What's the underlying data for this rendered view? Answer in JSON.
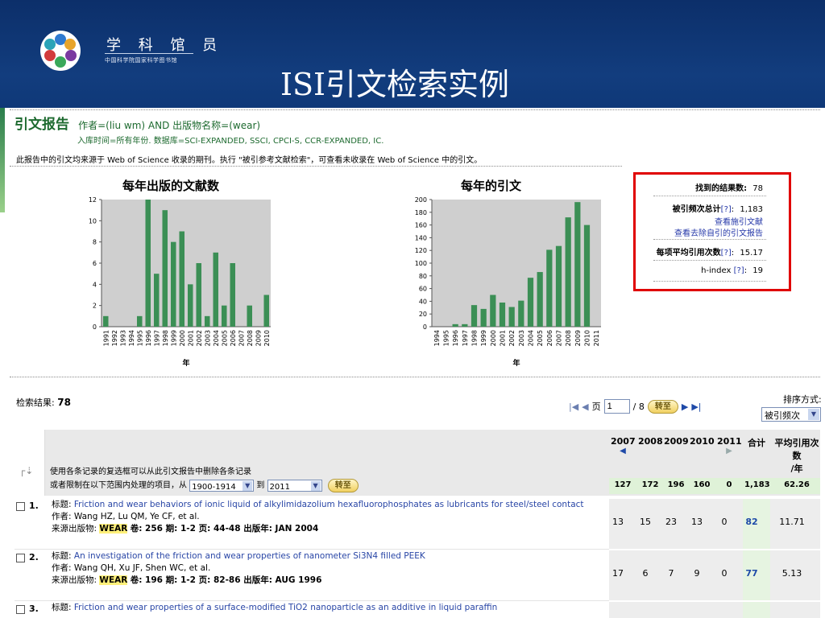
{
  "header": {
    "brand_name": "学 科 馆 员",
    "brand_sub": "中国科学院国家科学图书馆",
    "slide_title": "ISI引文检索实例"
  },
  "report": {
    "title": "引文报告",
    "query": "作者=(liu wm) AND 出版物名称=(wear)",
    "scope": "入库时间=所有年份. 数据库=SCI-EXPANDED, SSCI, CPCI-S, CCR-EXPANDED, IC.",
    "note": "此报告中的引文均来源于 Web of Science 收录的期刊。执行 \"被引参考文献检索\"，可查看未收录在 Web of Science 中的引文。"
  },
  "stats": {
    "results_label": "找到的结果数:",
    "results_value": "78",
    "citations_label": "被引频次总计",
    "citations_help": "[?]",
    "citations_value": "1,183",
    "link_citing": "查看施引文献",
    "link_no_self": "查看去除自引的引文报告",
    "avg_label": "每项平均引用次数",
    "avg_help": "[?]",
    "avg_value": "15.17",
    "hindex_label": "h-index",
    "hindex_help": "[?]",
    "hindex_value": "19"
  },
  "chart_data": [
    {
      "type": "bar",
      "title": "每年出版的文献数",
      "xlabel": "年",
      "ylabel": "",
      "categories": [
        "1991",
        "1992",
        "1993",
        "1994",
        "1995",
        "1996",
        "1997",
        "1998",
        "1999",
        "2000",
        "2001",
        "2002",
        "2003",
        "2004",
        "2005",
        "2006",
        "2007",
        "2008",
        "2009",
        "2010"
      ],
      "values": [
        1,
        0,
        0,
        0,
        1,
        12,
        5,
        11,
        8,
        9,
        4,
        6,
        1,
        7,
        2,
        6,
        0,
        2,
        0,
        3
      ],
      "ylim": [
        0,
        12
      ],
      "yticks": [
        0,
        2,
        4,
        6,
        8,
        10,
        12
      ],
      "grid": false,
      "color": "#3b8f55"
    },
    {
      "type": "bar",
      "title": "每年的引文",
      "xlabel": "年",
      "ylabel": "",
      "categories": [
        "1994",
        "1995",
        "1996",
        "1997",
        "1998",
        "1999",
        "2000",
        "2001",
        "2002",
        "2003",
        "2004",
        "2005",
        "2006",
        "2007",
        "2008",
        "2009",
        "2010",
        "2011"
      ],
      "values": [
        0,
        0,
        4,
        4,
        34,
        28,
        50,
        38,
        31,
        41,
        77,
        86,
        121,
        127,
        172,
        196,
        160,
        0
      ],
      "ylim": [
        0,
        200
      ],
      "yticks": [
        0,
        20,
        40,
        60,
        80,
        100,
        120,
        140,
        160,
        180,
        200
      ],
      "grid": false,
      "color": "#3b8f55"
    }
  ],
  "results_bar": {
    "label": "检索结果:",
    "count": "78",
    "page_label": "页",
    "page_value": "1",
    "page_total": "/ 8",
    "go_label": "转至",
    "sort_label": "排序方式:",
    "sort_value": "被引频次"
  },
  "table": {
    "info_line1": "使用各条记录的复选框可以从此引文报告中删除各条记录",
    "info_line2_prefix": "或者限制在以下范围内处理的项目，从",
    "range_from": "1900-1914",
    "range_to_label": "到",
    "range_to": "2011",
    "go_label": "转至",
    "columns": [
      "2007",
      "2008",
      "2009",
      "2010",
      "2011",
      "合计",
      "平均引用次数/年"
    ],
    "col_total": "合计",
    "col_avg_l1": "平均引用次",
    "col_avg_l2": "数",
    "col_avg_l3": "/年",
    "summary": [
      "127",
      "172",
      "196",
      "160",
      "0",
      "1,183",
      "62.26"
    ],
    "records": [
      {
        "index": "1.",
        "title_label": "标题:",
        "title": "Friction and wear behaviors of ionic liquid of alkylimidazolium hexafluorophosphates as lubricants for steel/steel contact",
        "authors_label": "作者:",
        "authors": "Wang HZ, Lu QM, Ye CF, et al.",
        "source_label": "来源出版物:",
        "journal": "WEAR",
        "source_rest": "卷: 256  期: 1-2  页: 44-48  出版年: JAN 2004",
        "counts": [
          "13",
          "15",
          "23",
          "13",
          "0",
          "82",
          "11.71"
        ]
      },
      {
        "index": "2.",
        "title_label": "标题:",
        "title": "An investigation of the friction and wear properties of nanometer Si3N4 filled PEEK",
        "authors_label": "作者:",
        "authors": "Wang QH, Xu JF, Shen WC, et al.",
        "source_label": "来源出版物:",
        "journal": "WEAR",
        "source_rest": "卷: 196  期: 1-2  页: 82-86  出版年: AUG 1996",
        "counts": [
          "17",
          "6",
          "7",
          "9",
          "0",
          "77",
          "5.13"
        ]
      },
      {
        "index": "3.",
        "title_label": "标题:",
        "title": "Friction and wear properties of a surface-modified TiO2 nanoparticle as an additive in liquid paraffin",
        "counts": []
      }
    ]
  }
}
